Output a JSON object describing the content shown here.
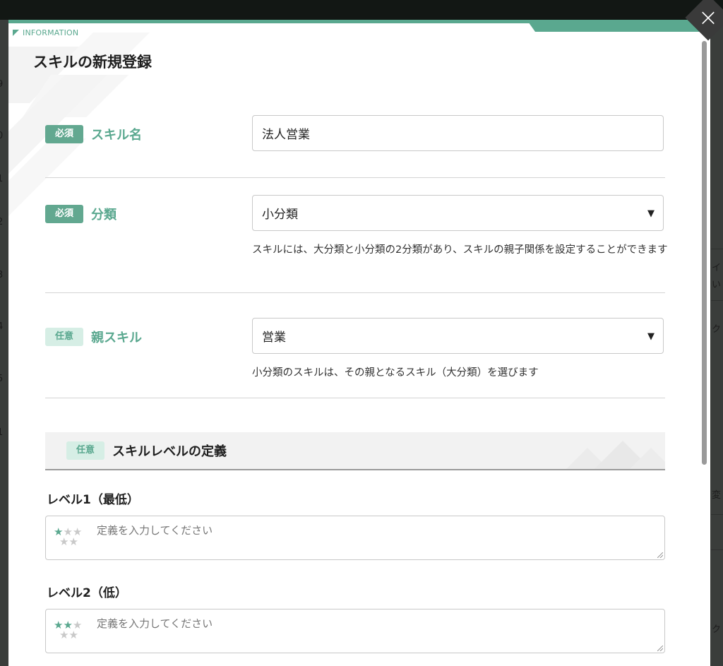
{
  "background": {
    "row_numbers": [
      "9",
      "0",
      "1",
      "2",
      "3",
      "4",
      "5",
      "1"
    ],
    "right_fragments": [
      "イ",
      "い",
      "ク",
      "変",
      "ク"
    ]
  },
  "modal": {
    "info_tag": "INFORMATION",
    "title": "スキルの新規登録",
    "close_label": "×"
  },
  "form": {
    "skill_name": {
      "badge": "必須",
      "label": "スキル名",
      "value": "法人営業"
    },
    "category": {
      "badge": "必須",
      "label": "分類",
      "selected": "小分類",
      "help": "スキルには、大分類と小分類の2分類があり、スキルの親子関係を設定することができます"
    },
    "parent_skill": {
      "badge": "任意",
      "label": "親スキル",
      "selected": "営業",
      "help": "小分類のスキルは、その親となるスキル（大分類）を選びます"
    }
  },
  "levels_section": {
    "badge": "任意",
    "title": "スキルレベルの定義",
    "levels": [
      {
        "label": "レベル1（最低）",
        "placeholder": "定義を入力してください",
        "stars_filled": 1,
        "stars_total": 5
      },
      {
        "label": "レベル2（低）",
        "placeholder": "定義を入力してください",
        "stars_filled": 2,
        "stars_total": 5
      }
    ]
  },
  "colors": {
    "accent": "#5aa88f",
    "badge_optional_bg": "#d6eee5",
    "overlay": "#3a3d3b"
  },
  "icons": {
    "select_arrow": "triangle-down-icon",
    "close": "close-icon",
    "star": "star-icon"
  }
}
